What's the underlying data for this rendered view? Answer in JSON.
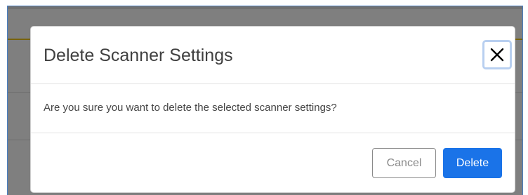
{
  "dialog": {
    "title": "Delete Scanner Settings",
    "message": "Are you sure you want to delete the selected scanner settings?",
    "close_icon": "close-icon",
    "cancel_label": "Cancel",
    "delete_label": "Delete"
  },
  "colors": {
    "primary": "#1a73e8",
    "accent_line": "#f0c419",
    "overlay": "rgba(0,0,0,0.5)"
  }
}
